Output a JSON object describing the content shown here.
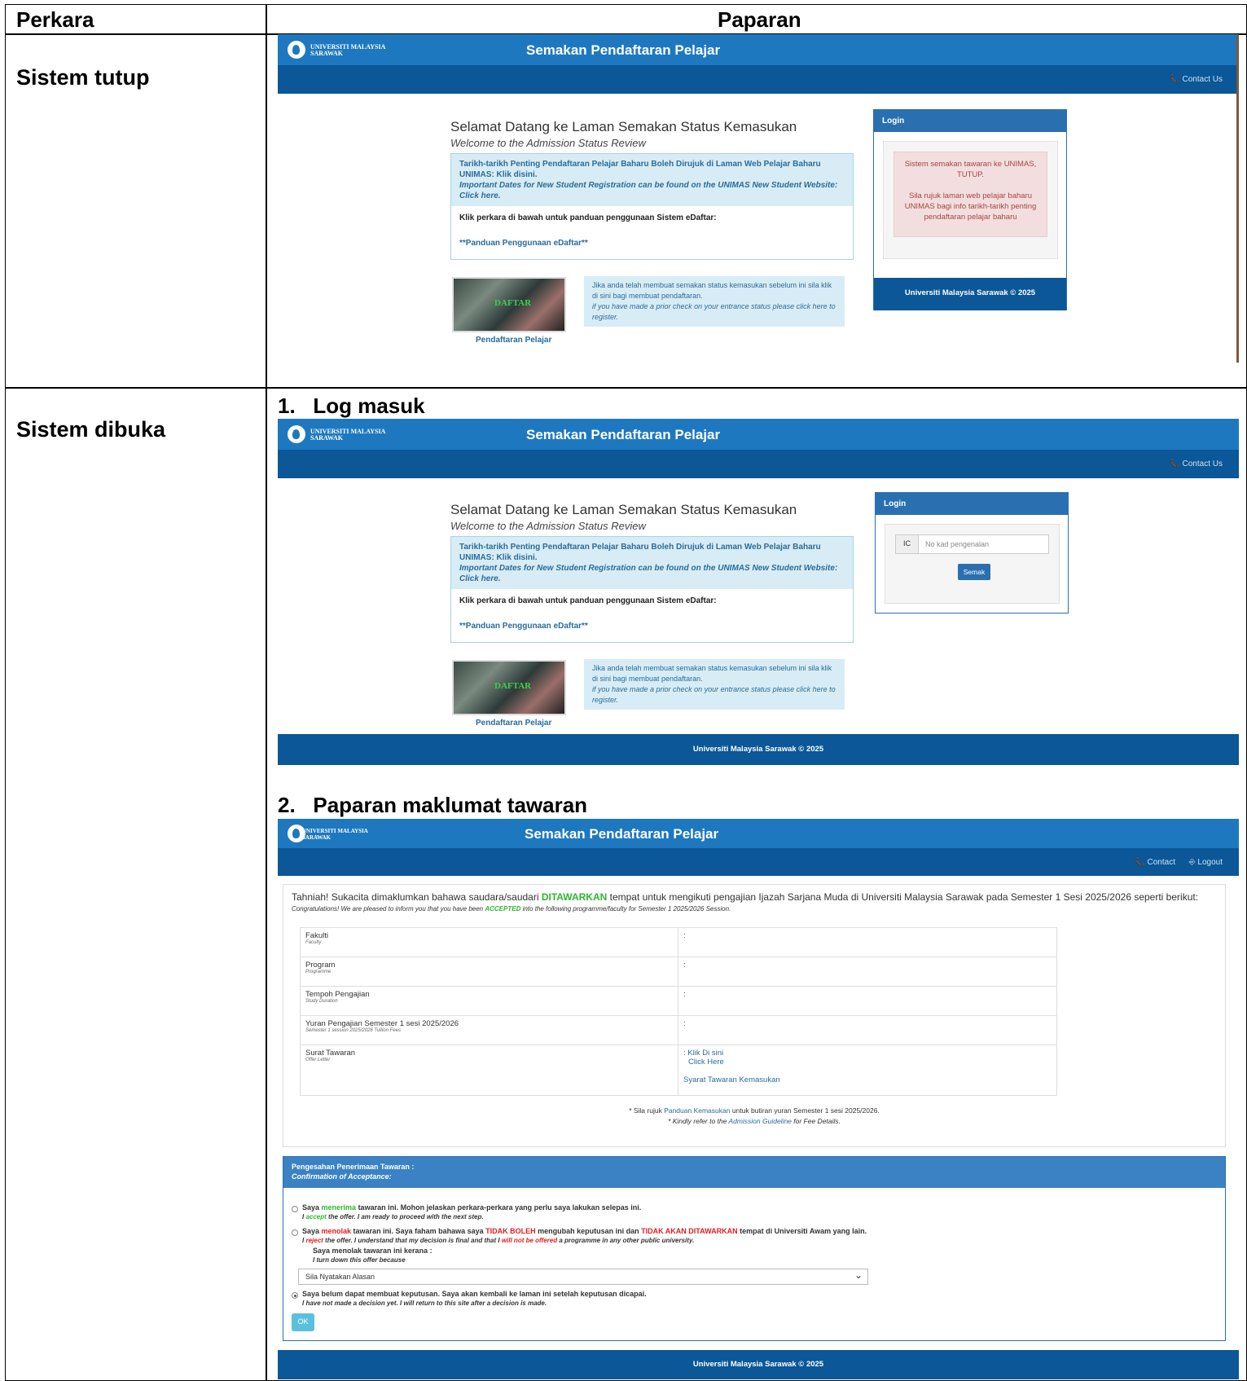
{
  "table": {
    "col1_header": "Perkara",
    "col2_header": "Paparan",
    "row1_label": "Sistem tutup",
    "row2_label": "Sistem dibuka",
    "step1": "1.   Log masuk",
    "step2": "2.   Paparan maklumat tawaran"
  },
  "app": {
    "logo_text_1": "UNIVERSITI MALAYSIA",
    "logo_text_2": "SARAWAK",
    "title": "Semakan Pendaftaran Pelajar",
    "contact": "📞 Contact Us",
    "contact_short": "📞 Contact",
    "logout": "⎆ Logout",
    "welcome_ms": "Selamat Datang ke Laman Semakan Status Kemasukan",
    "welcome_en": "Welcome to the Admission Status Review",
    "dates_ms": "Tarikh-tarikh Penting Pendaftaran Pelajar Baharu Boleh Dirujuk di Laman Web Pelajar Baharu UNIMAS: Klik disini.",
    "dates_en": "Important Dates for New Student Registration can be found on the UNIMAS New Student Website: Click here.",
    "guide_intro": "Klik perkara di bawah untuk panduan penggunaan Sistem eDaftar:",
    "guide_link": "**Panduan Penggunaan eDaftar**",
    "daftar_img_text": "DAFTAR",
    "daftar_label": "Pendaftaran Pelajar",
    "prior_ms": "Jika anda telah membuat semakan status kemasukan sebelum ini sila klik di sini bagi membuat pendaftaran.",
    "prior_en": "if you have made a prior check on your entrance status please click here to register.",
    "login_title": "Login",
    "closed_alert_1": "Sistem semakan tawaran ke UNIMAS, TUTUP.",
    "closed_alert_2": "Sila rujuk laman web pelajar baharu UNIMAS bagi info tarikh-tarikh penting pendaftaran pelajar baharu",
    "footer": "Universiti Malaysia Sarawak © 2025",
    "ic_label": "IC",
    "ic_placeholder": "No kad pengenalan",
    "semak_button": "Semak"
  },
  "offer": {
    "msg_ms_1": "Tahniah! Sukacita dimaklumkan bahawa saudara/saudari ",
    "msg_ms_hl": "DITAWARKAN",
    "msg_ms_2": " tempat untuk mengikuti pengajian Ijazah Sarjana Muda di Universiti Malaysia Sarawak pada Semester 1 Sesi 2025/2026 seperti berikut:",
    "msg_en_1": "Congratulations! We are pleased to inform you that you have been ",
    "msg_en_hl": "ACCEPTED",
    "msg_en_2": " into the following programme/faculty for Semester 1 2025/2026 Session.",
    "rows": [
      {
        "label": "Fakulti",
        "sub": "Faculty",
        "value": ":"
      },
      {
        "label": "Program",
        "sub": "Programme",
        "value": ":"
      },
      {
        "label": "Tempoh Pengajian",
        "sub": "Study Duration",
        "value": ":"
      },
      {
        "label": "Yuran Pengajian Semester 1 sesi 2025/2026",
        "sub": "Semester 1 session 2025/2026 Tuition Fees",
        "value": ":"
      },
      {
        "label": "Surat Tawaran",
        "sub": "Offer Letter",
        "value": ": Klik Di sini"
      }
    ],
    "click_here": "Click Here",
    "syarat": "Syarat Tawaran Kemasukan",
    "note_ms_1": "* Sila rujuk ",
    "note_ms_link": "Panduan Kemasukan",
    "note_ms_2": " untuk butiran yuran Semester 1 sesi 2025/2026.",
    "note_en_1": "* Kindly refer to the ",
    "note_en_link": "Admission Guideline",
    "note_en_2": " for Fee Details.",
    "confirm_title_ms": "Pengesahan Penerimaan Tawaran :",
    "confirm_title_en": "Confirmation of Acceptance:",
    "opt1_ms_1": "Saya ",
    "opt1_ms_hl": "menerima",
    "opt1_ms_2": " tawaran ini. Mohon jelaskan perkara-perkara yang perlu saya lakukan selepas ini.",
    "opt1_en_1": "I ",
    "opt1_en_hl": "accept",
    "opt1_en_2": " the offer. I am ready to proceed with the next step.",
    "opt2_ms_1": "Saya ",
    "opt2_ms_hl1": "menolak",
    "opt2_ms_2": " tawaran ini. Saya faham bahawa saya ",
    "opt2_ms_hl2": "TIDAK BOLEH",
    "opt2_ms_3": " mengubah keputusan ini dan ",
    "opt2_ms_hl3": "TIDAK AKAN DITAWARKAN",
    "opt2_ms_4": " tempat di Universiti Awam yang lain.",
    "opt2_en_1": "I ",
    "opt2_en_hl1": "reject",
    "opt2_en_2": " the offer. I understand that my decision is final and that I ",
    "opt2_en_hl2": "will not be offered",
    "opt2_en_3": " a programme in any other public university.",
    "reason_ms": "Saya menolak tawaran ini kerana :",
    "reason_en": "I turn down this offer because",
    "reason_select": "Sila Nyatakan Alasan",
    "opt3_ms": "Saya belum dapat membuat keputusan. Saya akan kembali ke laman ini setelah keputusan dicapai.",
    "opt3_en": "I have not made a decision yet. I will return to this site after a decision is made.",
    "ok_button": "OK"
  },
  "colors": {
    "topbar": "#1e78c0",
    "navbar": "#0b5797",
    "accept_green": "#2cb82c",
    "reject_red": "#e02020"
  }
}
